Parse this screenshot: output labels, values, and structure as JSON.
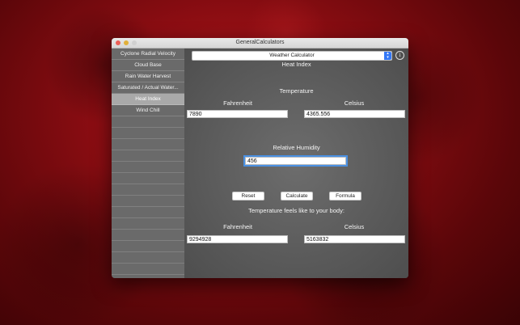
{
  "window": {
    "title": "GeneralCalculators"
  },
  "sidebar": {
    "items": [
      {
        "label": "Cyclone Radial Velocity"
      },
      {
        "label": "Cloud Base"
      },
      {
        "label": "Rain Water Harvest"
      },
      {
        "label": "Saturated / Actual Water..."
      },
      {
        "label": "Heat Index"
      },
      {
        "label": "Wind Chill"
      }
    ],
    "selected_index": 4
  },
  "header": {
    "calculator_select": "Weather Calculator",
    "page_title": "Heat Index"
  },
  "temperature": {
    "section_label": "Temperature",
    "fahrenheit_label": "Fahrenheit",
    "celsius_label": "Celsius",
    "fahrenheit_value": "7890",
    "celsius_value": "4365.556"
  },
  "humidity": {
    "label": "Relative Humidity",
    "value": "456"
  },
  "buttons": {
    "reset": "Reset",
    "calculate": "Calculate",
    "formula": "Formula"
  },
  "result": {
    "label": "Temperature feels like to your body:",
    "fahrenheit_label": "Fahrenheit",
    "celsius_label": "Celsius",
    "fahrenheit_value": "9294928",
    "celsius_value": "5163832"
  },
  "colors": {
    "accent": "#3478f6",
    "selected_item": "#a9a9a9",
    "background": "#8a0d12"
  }
}
